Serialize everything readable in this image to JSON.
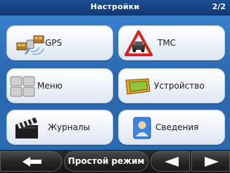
{
  "header": {
    "title": "Настройки",
    "page_indicator": "2/2"
  },
  "tiles": [
    {
      "label": "GPS"
    },
    {
      "label": "TMC"
    },
    {
      "label": "Меню"
    },
    {
      "label": "Устройство"
    },
    {
      "label": "Журналы"
    },
    {
      "label": "Сведения"
    }
  ],
  "footer": {
    "mode_label": "Простой режим"
  },
  "icons": {
    "back": "arrow-left-icon",
    "prev": "triangle-left-icon",
    "next": "triangle-right-icon"
  },
  "colors": {
    "background": "#2b6bb4",
    "title_bar": "#123a74",
    "footer": "#1a1a1a"
  }
}
